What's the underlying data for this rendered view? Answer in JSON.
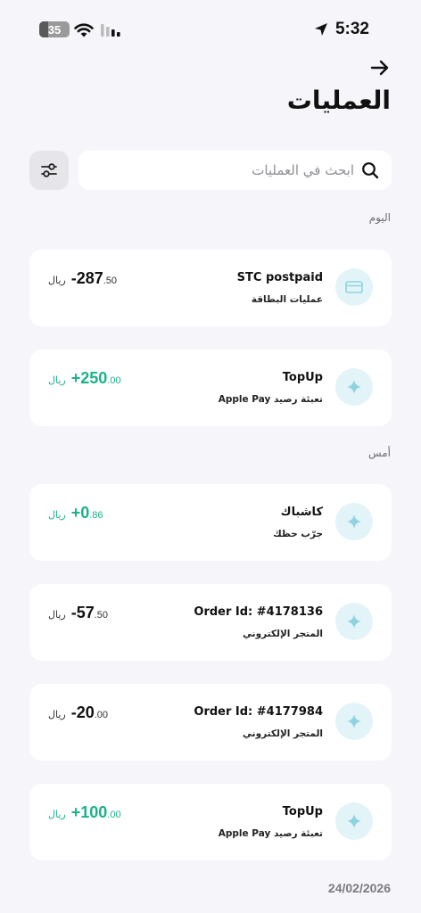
{
  "status_bar": {
    "battery": "35",
    "time": "5:32"
  },
  "header": {
    "title": "العمليات"
  },
  "search": {
    "placeholder": "ابحث في العمليات"
  },
  "sections": [
    {
      "label": "اليوم"
    },
    {
      "label": "أمس"
    }
  ],
  "transactions": [
    {
      "title": "STC postpaid",
      "subtitle": "عمليات البطاقة",
      "sign_int": "-287",
      "decimals": ".50",
      "currency": "ريال",
      "type": "debit",
      "icon": "card-icon"
    },
    {
      "title": "TopUp",
      "subtitle": "تعبئة رصيد Apple Pay",
      "sign_int": "+250",
      "decimals": ".00",
      "currency": "ريال",
      "type": "credit",
      "icon": "sparkle-icon"
    },
    {
      "title": "كاشباك",
      "subtitle": "جرّب حظك",
      "sign_int": "+0",
      "decimals": ".86",
      "currency": "ريال",
      "type": "credit",
      "icon": "sparkle-icon"
    },
    {
      "title": "Order Id: #4178136",
      "subtitle": "المتجر الإلكتروني",
      "sign_int": "-57",
      "decimals": ".50",
      "currency": "ريال",
      "type": "debit",
      "icon": "sparkle-icon"
    },
    {
      "title": "Order Id: #4177984",
      "subtitle": "المتجر الإلكتروني",
      "sign_int": "-20",
      "decimals": ".00",
      "currency": "ريال",
      "type": "debit",
      "icon": "sparkle-icon"
    },
    {
      "title": "TopUp",
      "subtitle": "تعبئة رصيد Apple Pay",
      "sign_int": "+100",
      "decimals": ".00",
      "currency": "ريال",
      "type": "credit",
      "icon": "sparkle-icon"
    }
  ],
  "footer": {
    "date": "24/02/2026"
  },
  "colors": {
    "background": "#f6f5fa",
    "credit": "#19b38a",
    "icon_bg": "#e3f4f8",
    "icon_fg": "#8fd3e0"
  }
}
